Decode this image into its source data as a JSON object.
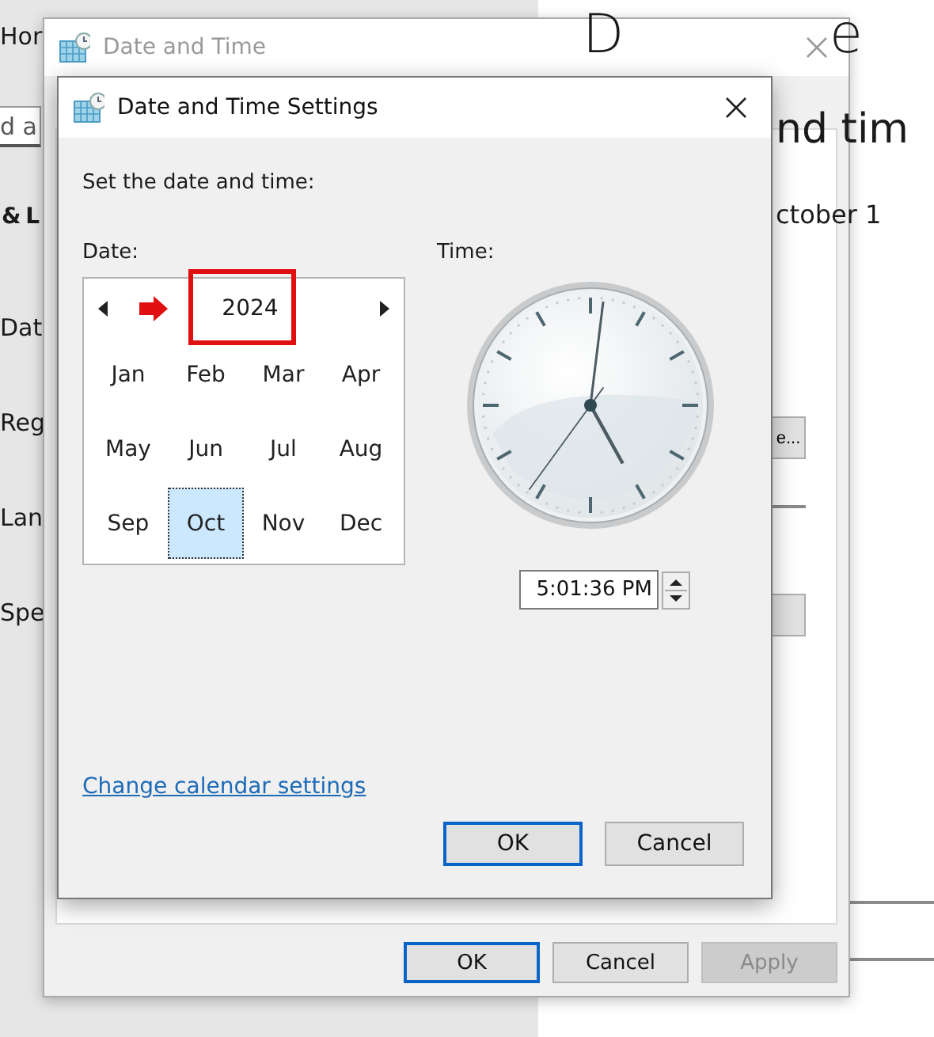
{
  "background_settings": {
    "sidebar": {
      "home": "Hor",
      "search_placeholder": "d a",
      "section": "& L",
      "items": [
        {
          "label": "Dat"
        },
        {
          "label": "Reg"
        },
        {
          "label": "Lan"
        },
        {
          "label": "Spe"
        }
      ]
    },
    "page": {
      "title_fragments": [
        "D",
        "e"
      ],
      "subtitle": "nd tim",
      "date_text": "ctober 1",
      "change_button": "e..."
    }
  },
  "date_time_window": {
    "title": "Date and Time",
    "active": false,
    "buttons": [
      {
        "label": "OK",
        "default": true,
        "disabled": false
      },
      {
        "label": "Cancel",
        "default": false,
        "disabled": false
      },
      {
        "label": "Apply",
        "default": false,
        "disabled": true
      }
    ]
  },
  "settings_dialog": {
    "title": "Date and Time Settings",
    "active": true,
    "instruction": "Set the date and time:",
    "date_label": "Date:",
    "calendar": {
      "year": "2024",
      "months": [
        {
          "label": "Jan",
          "selected": false
        },
        {
          "label": "Feb",
          "selected": false
        },
        {
          "label": "Mar",
          "selected": false
        },
        {
          "label": "Apr",
          "selected": false
        },
        {
          "label": "May",
          "selected": false
        },
        {
          "label": "Jun",
          "selected": false
        },
        {
          "label": "Jul",
          "selected": false
        },
        {
          "label": "Aug",
          "selected": false
        },
        {
          "label": "Sep",
          "selected": false
        },
        {
          "label": "Oct",
          "selected": true
        },
        {
          "label": "Nov",
          "selected": false
        },
        {
          "label": "Dec",
          "selected": false
        }
      ]
    },
    "time_label": "Time:",
    "time_value": "5:01:36 PM",
    "link": "Change calendar settings",
    "buttons": [
      {
        "label": "OK",
        "default": true,
        "disabled": false
      },
      {
        "label": "Cancel",
        "default": false,
        "disabled": false
      }
    ]
  }
}
